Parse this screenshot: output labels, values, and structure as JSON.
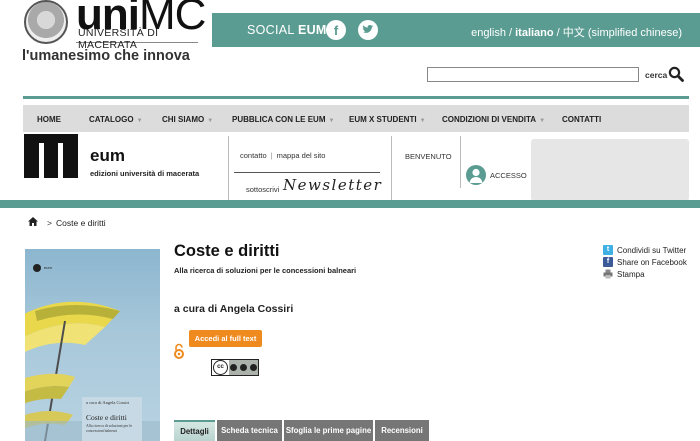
{
  "header": {
    "brand_uni": "uni",
    "brand_mc": "MC",
    "university": "UNIVERSITÀ DI MACERATA",
    "tagline": "l'umanesimo che innova",
    "social_prefix": "SOCIAL ",
    "social_brand": "EUM",
    "languages": {
      "english": "english",
      "sep1": " / ",
      "italiano": "italiano",
      "sep2": " / ",
      "chinese": "中文 (simplified chinese)"
    },
    "search_value": "",
    "search_label": "cerca"
  },
  "nav": {
    "items": [
      "HOME",
      "CATALOGO",
      "CHI SIAMO",
      "PUBBLICA CON LE EUM",
      "EUM X STUDENTI",
      "CONDIZIONI DI VENDITA",
      "CONTATTI"
    ]
  },
  "eum": {
    "title": "eum",
    "subtitle": "edizioni università di macerata",
    "contatto": "contatto",
    "pipe": "|",
    "mappa": "mappa del sito",
    "sottoscrivi": "sottoscrivi",
    "newsletter": "Newsletter",
    "benvenuto": "BENVENUTO",
    "accesso": "ACCESSO"
  },
  "breadcrumb": {
    "sep": ">",
    "current": "Coste e diritti"
  },
  "cover": {
    "publisher": "eum",
    "curatore": "a cura di Angela Cossiri",
    "title": "Coste e diritti",
    "subtitle": "Alla ricerca di soluzioni per le concessioni balneari"
  },
  "book": {
    "title": "Coste e diritti",
    "subtitle": "Alla ricerca di soluzioni per le concessioni balneari",
    "curator": "a cura di Angela Cossiri",
    "full_text_button": "Accedi al full text",
    "cc_label": "cc"
  },
  "share": {
    "twitter": "Condividi su Twitter",
    "facebook": "Share on Facebook",
    "print": "Stampa"
  },
  "tabs": [
    "Dettagli",
    "Scheda tecnica",
    "Sfoglia le prime pagine",
    "Recensioni"
  ],
  "colors": {
    "accent": "#5a9c91",
    "orange": "#ef8a1e",
    "nav_bg": "#dcdcdc"
  }
}
